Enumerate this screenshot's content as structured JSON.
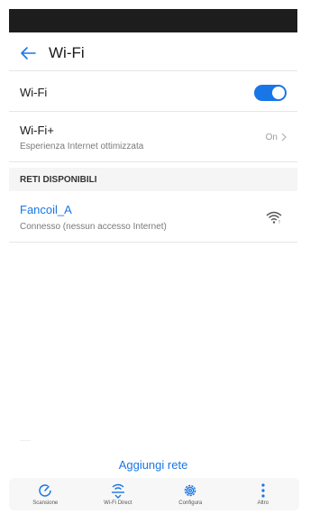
{
  "header": {
    "back_icon": "arrow-left-icon",
    "title": "Wi-Fi"
  },
  "wifi_row": {
    "label": "Wi-Fi",
    "toggle_on": true,
    "accent": "#1976e6"
  },
  "wifi_plus": {
    "title": "Wi-Fi+",
    "subtitle": "Esperienza Internet ottimizzata",
    "value": "On",
    "chevron_icon": "chevron-right-icon"
  },
  "section": {
    "title": "RETI DISPONIBILI"
  },
  "networks": [
    {
      "name": "Fancoil_A",
      "status": "Connesso (nessun accesso Internet)",
      "icon": "wifi-signal-icon"
    }
  ],
  "add_network": "Aggiungi rete",
  "bottom_bar": [
    {
      "label": "Scansione",
      "icon": "refresh-icon"
    },
    {
      "label": "Wi-Fi Direct",
      "icon": "wifi-direct-icon"
    },
    {
      "label": "Configura",
      "icon": "gear-icon"
    },
    {
      "label": "Altro",
      "icon": "more-vertical-icon"
    }
  ]
}
